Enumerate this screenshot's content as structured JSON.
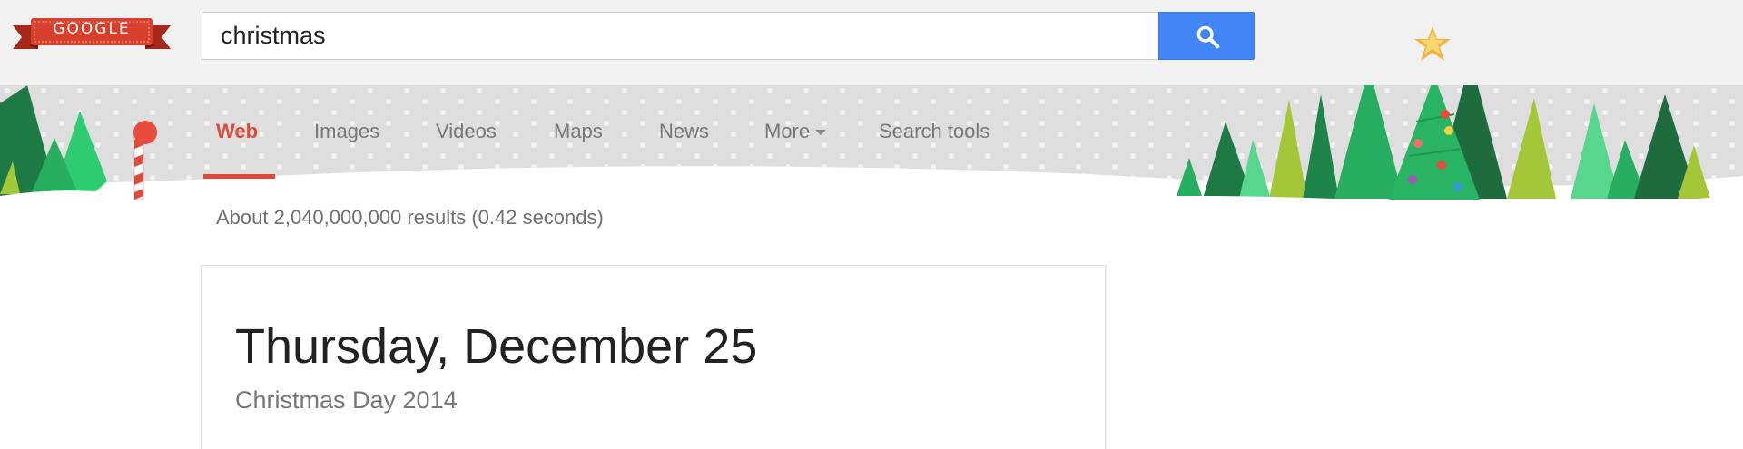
{
  "logo": {
    "text": "GOOGLE"
  },
  "search": {
    "query": "christmas"
  },
  "nav": {
    "items": [
      {
        "label": "Web",
        "active": true
      },
      {
        "label": "Images"
      },
      {
        "label": "Videos"
      },
      {
        "label": "Maps"
      },
      {
        "label": "News"
      },
      {
        "label": "More"
      },
      {
        "label": "Search tools"
      }
    ]
  },
  "results": {
    "count_text": "About 2,040,000,000 results (0.42 seconds)"
  },
  "card": {
    "title": "Thursday, December 25",
    "subtitle": "Christmas Day 2014"
  },
  "colors": {
    "accent_red": "#dd4b39",
    "search_blue": "#4285f4",
    "tree_green": "#1e8449",
    "band_gray": "#dedede"
  },
  "icons": {
    "search": "search-icon",
    "more": "chevron-down-icon",
    "decor": [
      "christmas-tree-icon",
      "star-icon",
      "north-pole-icon"
    ]
  }
}
